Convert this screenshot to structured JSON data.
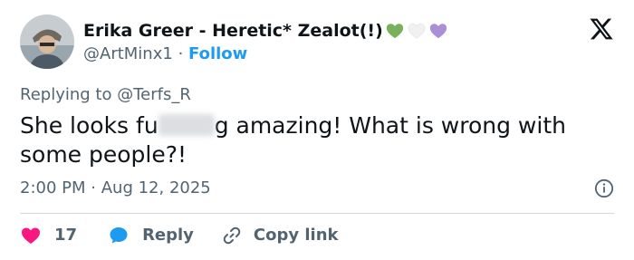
{
  "author": {
    "display_name": "Erika Greer - Heretic* Zealot(!)",
    "handle": "@ArtMinx1",
    "separator": "·",
    "follow_label": "Follow",
    "heart_colors": [
      "#78b159",
      "#f1f1f1",
      "#aa8ed6"
    ]
  },
  "reply_context": {
    "prefix": "Replying to",
    "target": "@Terfs_R"
  },
  "tweet": {
    "text_before": "She looks fu",
    "text_after": "g amazing! What is wrong with some people?!"
  },
  "timestamp": {
    "time": "2:00 PM",
    "separator": "·",
    "date": "Aug 12, 2025"
  },
  "actions": {
    "like_count": "17",
    "reply_label": "Reply",
    "copy_label": "Copy link"
  },
  "icons": {
    "brand": "x-logo-icon",
    "info": "info-icon",
    "like": "heart-icon",
    "reply": "chat-bubble-icon",
    "copy": "link-icon"
  },
  "colors": {
    "link": "#1d9bf0",
    "secondary_text": "#536471",
    "like": "#f91880",
    "divider": "#cfd9de"
  }
}
